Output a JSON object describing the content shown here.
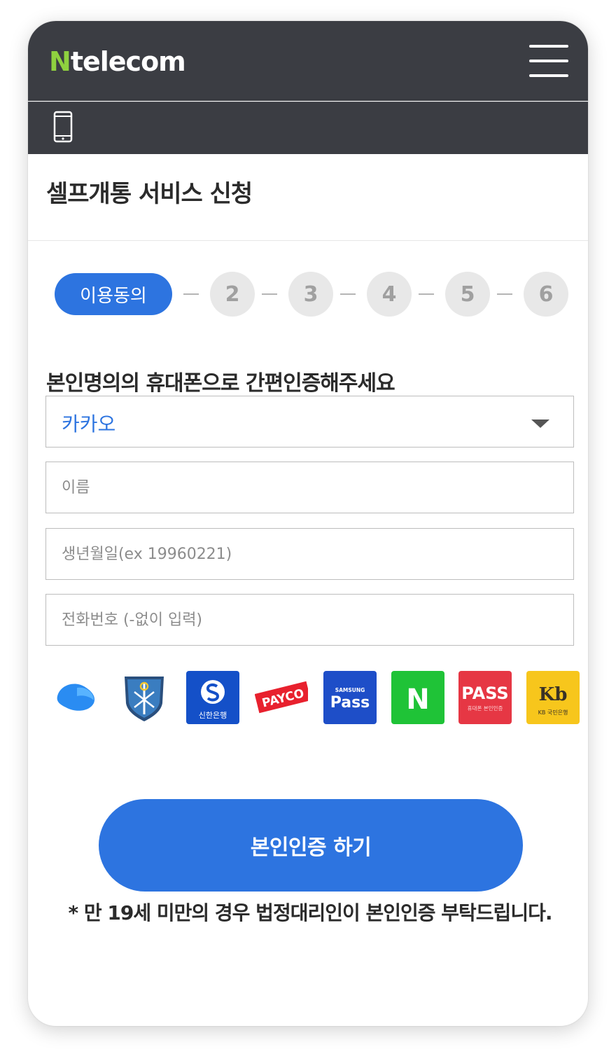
{
  "header": {
    "brand_prefix": "N",
    "brand_name": "telecom",
    "menu_icon": "hamburger-menu-icon",
    "device_icon": "mobile-phone-icon"
  },
  "page": {
    "title": "셀프개통 서비스 신청"
  },
  "steps": {
    "active_label": "이용동의",
    "items": [
      "2",
      "3",
      "4",
      "5",
      "6"
    ]
  },
  "form": {
    "instruction": "본인명의의 휴대폰으로 간편인증해주세요",
    "provider_select": {
      "value": "카카오"
    },
    "name_placeholder": "이름",
    "birth_placeholder": "생년월일(ex 19960221)",
    "phone_placeholder": "전화번호 (-없이 입력)"
  },
  "providers": [
    {
      "icon": "toss-icon"
    },
    {
      "icon": "shield-cert-icon"
    },
    {
      "icon": "shinhan-bank-icon",
      "subtext": "신한은행"
    },
    {
      "icon": "payco-icon",
      "label": "PAYCO"
    },
    {
      "icon": "samsung-pass-icon",
      "label": "Pass",
      "subtext": "SAMSUNG"
    },
    {
      "icon": "naver-icon",
      "label": "N"
    },
    {
      "icon": "pass-icon",
      "label": "PASS",
      "subtext": "휴대폰 본인인증"
    },
    {
      "icon": "kb-bank-icon",
      "label": "Kb",
      "subtext": "KB 국민은행"
    }
  ],
  "cta": {
    "label": "본인인증 하기"
  },
  "note": "* 만 19세 미만의 경우 법정대리인이 본인인증 부탁드립니다.",
  "colors": {
    "header_bg": "#3b3d43",
    "accent": "#2d74e0",
    "brand_green": "#8fd13f"
  }
}
